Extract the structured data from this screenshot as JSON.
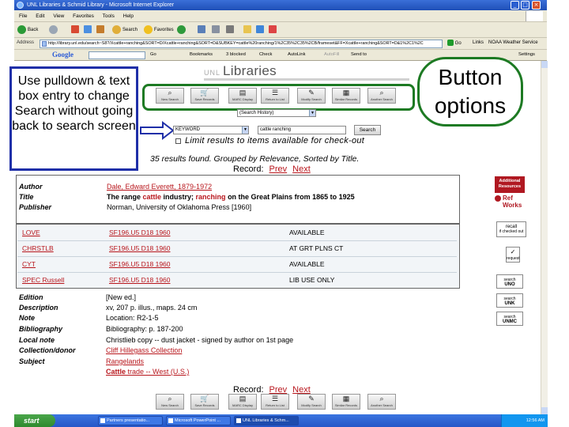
{
  "window": {
    "title": "UNL Libraries & Schmid Library - Microsoft Internet Explorer",
    "minimize": "_",
    "maximize": "□",
    "close": "×"
  },
  "menu": [
    "File",
    "Edit",
    "View",
    "Favorites",
    "Tools",
    "Help"
  ],
  "toolbar": {
    "back": "Back",
    "search": "Search",
    "favorites": "Favorites"
  },
  "address": {
    "label": "Address",
    "url": "http://library.unl.edu/search~S8?/Xcattle+ranching&SORT=D/Xcattle+ranching&SORT=D&SUBKEY=cattle%20ranching/1%2C35%2C35%2CB/frameset&FF=Xcattle+ranching&SORT=D&1%2C1%2C",
    "go": "Go",
    "links": "Links",
    "noaa": "NOAA Weather Service"
  },
  "google_bar": {
    "logo": "Google",
    "go": "Go",
    "bookmarks": "Bookmarks",
    "blocked": "3 blocked",
    "check": "Check",
    "autolink": "AutoLink",
    "autofill": "AutoFill",
    "send_to": "Send to",
    "settings": "Settings"
  },
  "catalog": {
    "logo_prefix": "UNL",
    "logo_text": "Libraries",
    "buttons": [
      {
        "label": "New Search",
        "icon": "magnifier-icon"
      },
      {
        "label": "Save Records",
        "icon": "cart-icon"
      },
      {
        "label": "MARC Display",
        "icon": "document-icon"
      },
      {
        "label": "Return to List",
        "icon": "list-icon"
      },
      {
        "label": "Modify Search",
        "icon": "modify-icon"
      },
      {
        "label": "Similar Records",
        "icon": "records-icon"
      },
      {
        "label": "Another Search",
        "icon": "magnifier-icon"
      }
    ],
    "search_history": "(Search History)",
    "field_select": "KEYWORD",
    "search_text": "cattle ranching",
    "search_button": "Search",
    "limit_text": "Limit results to items available for check-out",
    "results_line": "35 results found. Grouped by Relevance, Sorted by Title.",
    "record_label": "Record:",
    "prev": "Prev",
    "next": "Next"
  },
  "record": {
    "author_label": "Author",
    "author": "Dale, Edward Everett, 1879-1972",
    "title_label": "Title",
    "title_parts": [
      "The range ",
      "cattle",
      " industry; ",
      "ranching",
      " on the Great Plains from 1865 to 1925"
    ],
    "publisher_label": "Publisher",
    "publisher": "Norman, University of Oklahoma Press [1960]"
  },
  "holdings": [
    {
      "location": "LOVE",
      "call": "SF196.U5 D18 1960",
      "status": "AVAILABLE"
    },
    {
      "location": "CHRSTLB",
      "call": "SF196.U5 D18 1960",
      "status": "AT GRT PLNS CT"
    },
    {
      "location": "CYT",
      "call": "SF196.U5 D18 1960",
      "status": "AVAILABLE"
    },
    {
      "location": "SPEC Russell",
      "call": "SF196.U5 D18 1960",
      "status": "LIB USE ONLY"
    }
  ],
  "details": [
    {
      "label": "Edition",
      "value": "[New ed.]",
      "link": false
    },
    {
      "label": "Description",
      "value": "xv, 207 p. illus., maps. 24 cm",
      "link": false
    },
    {
      "label": "Note",
      "value": "Location: R2-1-5",
      "link": false
    },
    {
      "label": "Bibliography",
      "value": "Bibliography: p. 187-200",
      "link": false
    },
    {
      "label": "Local note",
      "value": "Christlieb copy -- dust jacket - signed by author on 1st page",
      "link": false
    },
    {
      "label": "Collection/donor",
      "value": "Cliff Hillegass Collection",
      "link": true
    },
    {
      "label": "Subject",
      "value": "Rangelands",
      "link": true
    }
  ],
  "subject2": {
    "hl": "Cattle",
    "rest": " trade -- West (U.S.)"
  },
  "sidebar": {
    "additional_resources": "Additional Resources",
    "refworks_top": "Ref",
    "refworks_bottom": "Works",
    "recall": "recall",
    "recall_sub": "if checked out",
    "request": "request",
    "search_uno": "search",
    "search_uno_sub": "UNO",
    "search_unk": "search",
    "search_unk_sub": "UNK",
    "search_unmc": "search",
    "search_unmc_sub": "UNMC"
  },
  "callouts": {
    "left": "Use pulldown & text box entry to change Search without going back to search screen",
    "right": "Button options"
  },
  "taskbar": {
    "start": "start",
    "items": [
      "Partners presentatio...",
      "Microsoft PowerPoint ...",
      "UNL Libraries & Schm..."
    ],
    "time": "12:56 AM"
  },
  "colors": {
    "link_red": "#b8161c",
    "callout_blue": "#1f2fa8",
    "callout_green": "#1d7a23"
  }
}
